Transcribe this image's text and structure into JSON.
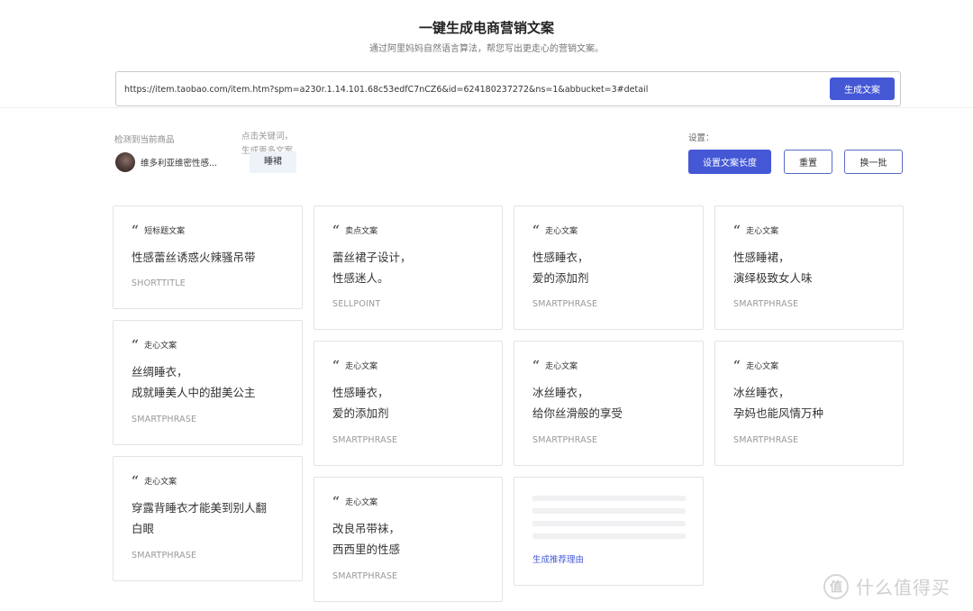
{
  "header": {
    "title": "一键生成电商营销文案",
    "subtitle": "通过阿里妈妈自然语言算法，帮您写出更走心的营销文案。"
  },
  "url_bar": {
    "value": "https://item.taobao.com/item.htm?spm=a230r.1.14.101.68c53edfC7nCZ6&id=624180237272&ns=1&abbucket=3#detail",
    "generate_label": "生成文案"
  },
  "product": {
    "detect_label": "检测到当前商品",
    "name": "维多利亚维密性感...",
    "keyword_hint": "点击关键词，生成更多文案",
    "keyword": "睡裙"
  },
  "settings": {
    "label": "设置：",
    "length_label": "设置文案长度",
    "reset_label": "重置",
    "swap_label": "换一批"
  },
  "cards": [
    {
      "type": "短标题文案",
      "text": "性感蕾丝诱惑火辣骚吊带",
      "tag": "SHORTTITLE"
    },
    {
      "type": "走心文案",
      "text": "丝绸睡衣，\n成就睡美人中的甜美公主",
      "tag": "SMARTPHRASE"
    },
    {
      "type": "走心文案",
      "text": "穿露背睡衣才能美到别人翻\n白眼",
      "tag": "SMARTPHRASE"
    },
    {
      "type": "卖点文案",
      "text": "蕾丝裙子设计，\n性感迷人。",
      "tag": "SELLPOINT"
    },
    {
      "type": "走心文案",
      "text": "性感睡衣，\n爱的添加剂",
      "tag": "SMARTPHRASE"
    },
    {
      "type": "走心文案",
      "text": "改良吊带袜，\n西西里的性感",
      "tag": "SMARTPHRASE"
    },
    {
      "type": "走心文案",
      "text": "性感睡衣，\n爱的添加剂",
      "tag": "SMARTPHRASE"
    },
    {
      "type": "走心文案",
      "text": "冰丝睡衣，\n给你丝滑般的享受",
      "tag": "SMARTPHRASE"
    },
    {
      "type": "走心文案",
      "text": "性感睡裙，\n演绎极致女人味",
      "tag": "SMARTPHRASE"
    },
    {
      "type": "走心文案",
      "text": "冰丝睡衣，\n孕妈也能风情万种",
      "tag": "SMARTPHRASE"
    }
  ],
  "loading_card": {
    "link_label": "生成推荐理由"
  },
  "watermark": {
    "logo_glyph": "值",
    "text": "什么值得买"
  },
  "colors": {
    "accent": "#4458d6",
    "border": "#e3e3e6",
    "tag_gray": "#999999"
  }
}
